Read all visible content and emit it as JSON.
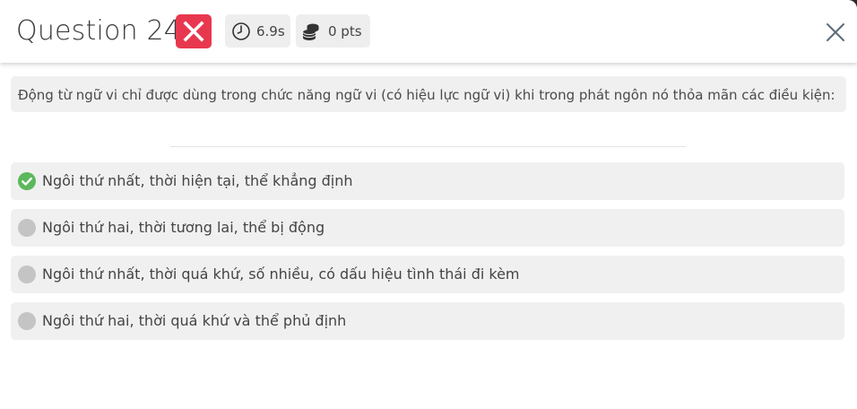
{
  "header": {
    "title": "Question 24",
    "result_icon": "x-mark-icon",
    "time": "6.9s",
    "time_icon": "clock-icon",
    "points": "0 pts",
    "points_icon": "coins-icon",
    "close_icon": "close-icon"
  },
  "question": {
    "text": "Động từ ngữ vi chỉ được dùng trong chức năng ngữ vi (có hiệu lực ngữ vi) khi trong phát ngôn nó thỏa mãn các điều kiện:"
  },
  "options": [
    {
      "label": "Ngôi thứ nhất, thời hiện tại, thể khẳng định",
      "state": "correct"
    },
    {
      "label": "Ngôi thứ hai, thời tương lai, thể bị động",
      "state": "neutral"
    },
    {
      "label": "Ngôi thứ nhất, thời quá khứ, số nhiều, có dấu hiệu tình thái đi kèm",
      "state": "neutral"
    },
    {
      "label": "Ngôi thứ hai, thời quá khứ và thể phủ định",
      "state": "neutral"
    }
  ],
  "colors": {
    "incorrect": "#e8384f",
    "correct": "#5cb85c",
    "neutral": "#c4c4c4",
    "panel_bg": "#f0f0f0"
  }
}
